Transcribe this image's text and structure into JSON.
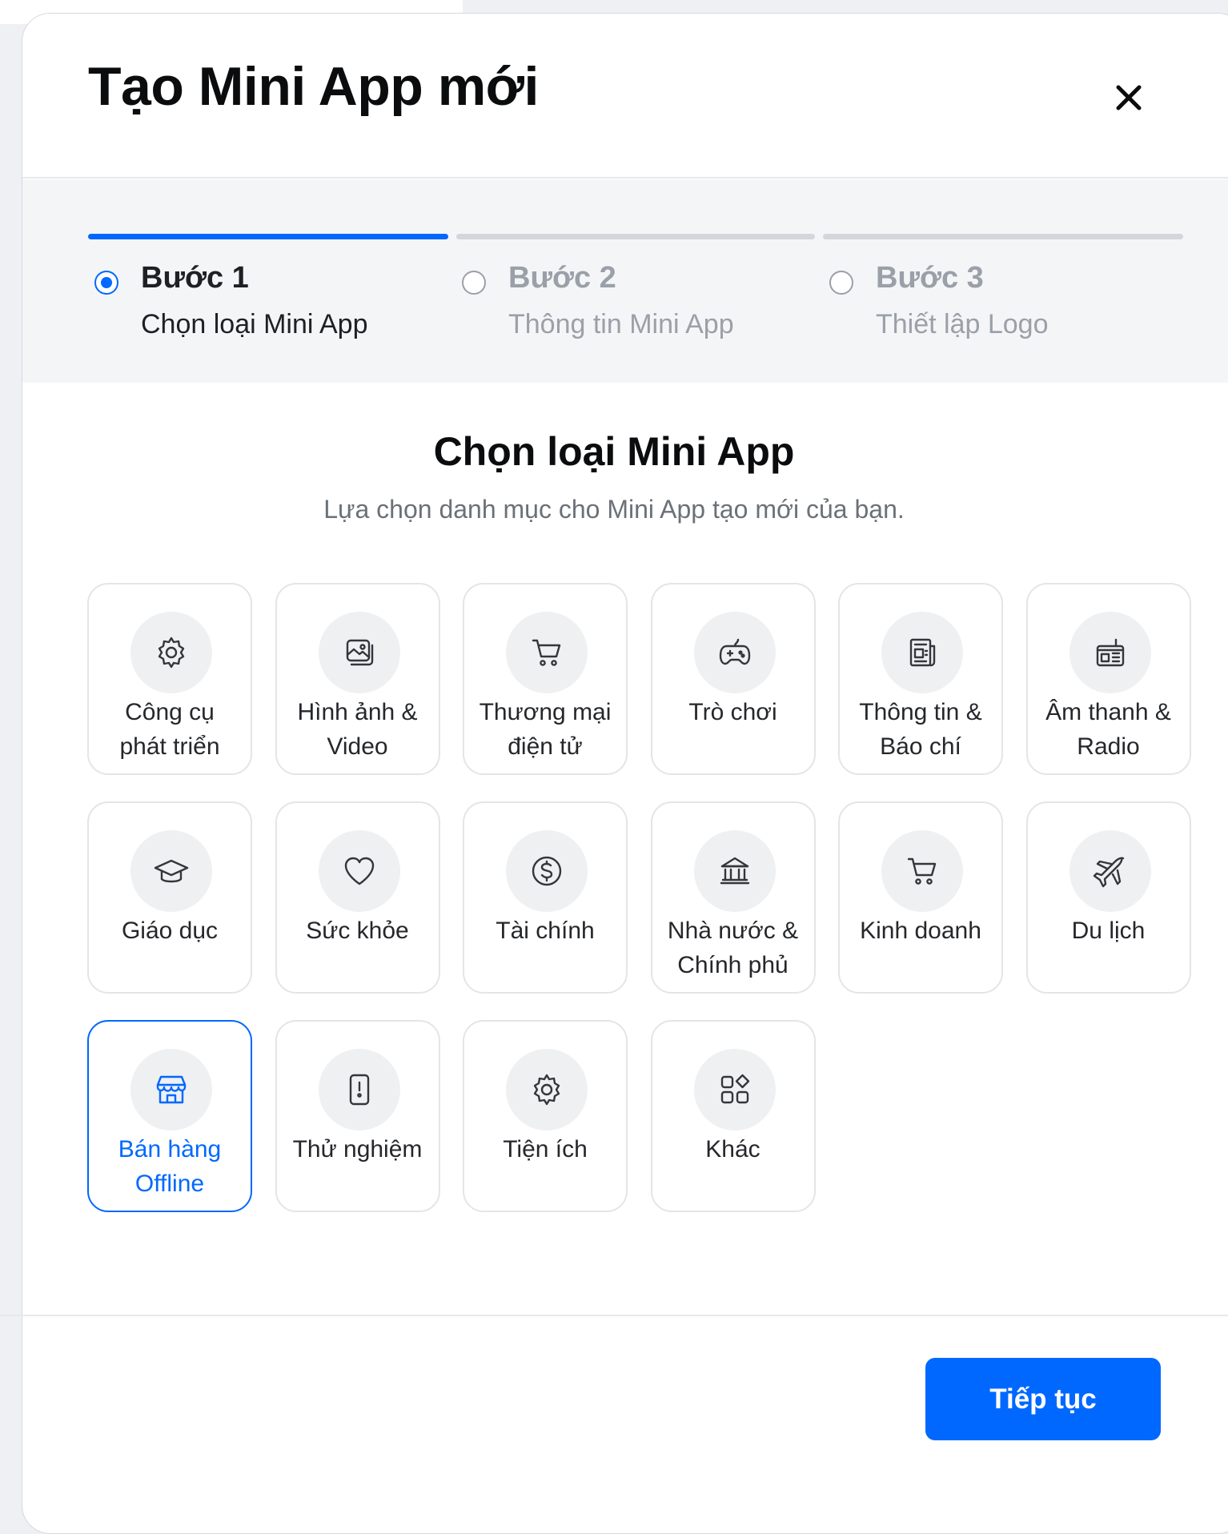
{
  "modal": {
    "title": "Tạo Mini App mới",
    "close_icon": "close-icon"
  },
  "stepper": {
    "steps": [
      {
        "title": "Bước 1",
        "subtitle": "Chọn loại Mini App",
        "active": true
      },
      {
        "title": "Bước 2",
        "subtitle": "Thông tin Mini App",
        "active": false
      },
      {
        "title": "Bước 3",
        "subtitle": "Thiết lập Logo",
        "active": false
      }
    ]
  },
  "content": {
    "title": "Chọn loại Mini App",
    "subtitle": "Lựa chọn danh mục cho Mini App tạo mới của bạn."
  },
  "categories": [
    {
      "label": "Công cụ\nphát triển",
      "icon": "gear-icon",
      "selected": false
    },
    {
      "label": "Hình ảnh &\nVideo",
      "icon": "image-icon",
      "selected": false
    },
    {
      "label": "Thương mại\nđiện tử",
      "icon": "cart-icon",
      "selected": false
    },
    {
      "label": "Trò chơi",
      "icon": "gamepad-icon",
      "selected": false
    },
    {
      "label": "Thông tin &\nBáo chí",
      "icon": "newspaper-icon",
      "selected": false
    },
    {
      "label": "Âm thanh &\nRadio",
      "icon": "radio-icon",
      "selected": false
    },
    {
      "label": "Giáo dục",
      "icon": "graduation-cap-icon",
      "selected": false
    },
    {
      "label": "Sức khỏe",
      "icon": "heart-icon",
      "selected": false
    },
    {
      "label": "Tài chính",
      "icon": "dollar-icon",
      "selected": false
    },
    {
      "label": "Nhà nước &\nChính phủ",
      "icon": "government-building-icon",
      "selected": false
    },
    {
      "label": "Kinh doanh",
      "icon": "cart-icon",
      "selected": false
    },
    {
      "label": "Du lịch",
      "icon": "airplane-icon",
      "selected": false
    },
    {
      "label": "Bán hàng\nOffline",
      "icon": "store-icon",
      "selected": true
    },
    {
      "label": "Thử nghiệm",
      "icon": "phone-alert-icon",
      "selected": false
    },
    {
      "label": "Tiện ích",
      "icon": "gear-icon",
      "selected": false
    },
    {
      "label": "Khác",
      "icon": "apps-grid-icon",
      "selected": false
    }
  ],
  "footer": {
    "continue_label": "Tiếp tục"
  },
  "colors": {
    "accent": "#0068ff",
    "text": "#0b0c0e",
    "muted": "#9aa0a8"
  }
}
